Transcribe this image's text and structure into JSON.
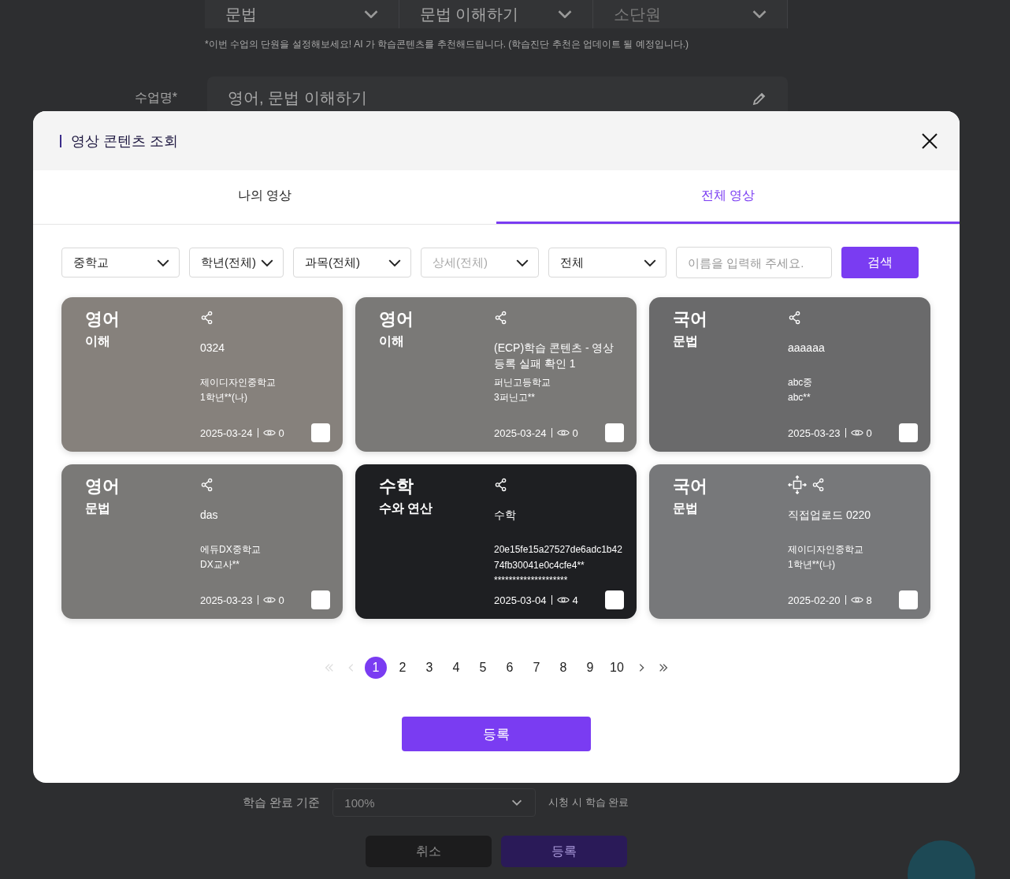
{
  "background_page": {
    "unit_selects": [
      {
        "value": "문법",
        "placeholder": false
      },
      {
        "value": "문법 이해하기",
        "placeholder": false
      },
      {
        "value": "소단원",
        "placeholder": true
      }
    ],
    "unit_hint": "*이번 수업의 단원을 설정해보세요! AI 가 학습콘텐츠를 추천해드립니다. (학습진단 추천은 업데이트 될 예정입니다.)",
    "class_name_label": "수업명*",
    "class_name_value": "영어, 문법 이해하기",
    "completion_label": "학습 완료 기준",
    "completion_value": "100%",
    "completion_note": "시청 시 학습 완료",
    "buttons": [
      {
        "label": "취소",
        "kind": "cancel"
      },
      {
        "label": "등록",
        "kind": "primary"
      }
    ]
  },
  "modal": {
    "title": "영상 콘텐츠 조회",
    "tabs": [
      {
        "label": "나의 영상",
        "selected": false
      },
      {
        "label": "전체 영상",
        "selected": true
      }
    ],
    "filters": [
      {
        "value": "중학교",
        "disabled": false
      },
      {
        "value": "학년(전체)",
        "disabled": false
      },
      {
        "value": "과목(전체)",
        "disabled": false
      },
      {
        "value": "상세(전체)",
        "disabled": true
      },
      {
        "value": "전체",
        "disabled": false
      }
    ],
    "search": {
      "placeholder": "이름을 입력해 주세요."
    },
    "search_button": "검색",
    "cards": [
      {
        "subject": "영어",
        "topic": "이해",
        "title": "0324",
        "school": "제이디자인중학교",
        "teacher": "1학년**(나)",
        "date": "2025-03-24",
        "views": "0",
        "thumbnail": true,
        "uploaded": false,
        "checked": false
      },
      {
        "subject": "영어",
        "topic": "이해",
        "title": "(ECP)학습 콘텐츠 - 영상 등록 실패 확인 1",
        "school": "퍼닌고등학교",
        "teacher": "3퍼닌고**",
        "date": "2025-03-24",
        "views": "0",
        "thumbnail": false,
        "uploaded": false,
        "checked": false
      },
      {
        "subject": "국어",
        "topic": "문법",
        "title": "aaaaaa",
        "school": "abc중",
        "teacher": "abc**",
        "date": "2025-03-23",
        "views": "0",
        "thumbnail": true,
        "uploaded": false,
        "checked": false
      },
      {
        "subject": "영어",
        "topic": "문법",
        "title": "das",
        "school": "에듀DX중학교",
        "teacher": "DX교사**",
        "date": "2025-03-23",
        "views": "0",
        "thumbnail": false,
        "uploaded": false,
        "checked": false
      },
      {
        "subject": "수학",
        "topic": "수와 연산",
        "title": "수학",
        "school": "20e15fe15a27527de6adc1b4274fb30041e0c4cfe4**",
        "teacher": "********************",
        "date": "2025-03-04",
        "views": "4",
        "thumbnail": true,
        "uploaded": false,
        "checked": false
      },
      {
        "subject": "국어",
        "topic": "문법",
        "title": "직접업로드 0220",
        "school": "제이디자인중학교",
        "teacher": "1학년**(나)",
        "date": "2025-02-20",
        "views": "8",
        "thumbnail": true,
        "uploaded": true,
        "checked": false
      }
    ],
    "pagination": {
      "first_disabled": true,
      "prev_disabled": true,
      "pages": [
        {
          "label": "1",
          "selected": true
        },
        {
          "label": "2",
          "selected": false
        },
        {
          "label": "3",
          "selected": false
        },
        {
          "label": "4",
          "selected": false
        },
        {
          "label": "5",
          "selected": false
        },
        {
          "label": "6",
          "selected": false
        },
        {
          "label": "7",
          "selected": false
        },
        {
          "label": "8",
          "selected": false
        },
        {
          "label": "9",
          "selected": false
        },
        {
          "label": "10",
          "selected": false
        }
      ]
    },
    "submit_button": "등록"
  }
}
